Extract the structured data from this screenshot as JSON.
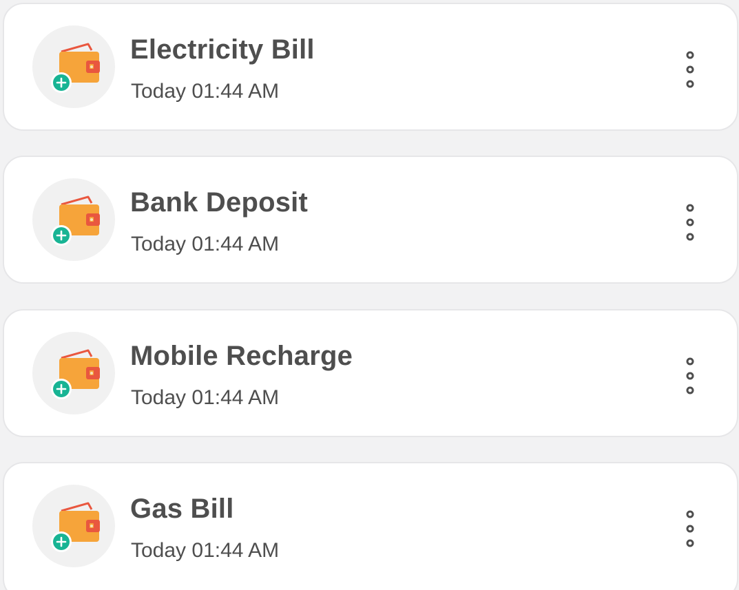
{
  "colors": {
    "card_background": "#ffffff",
    "page_background": "#f2f2f3",
    "icon_circle": "#f1f1f1",
    "wallet_orange": "#f6a43a",
    "wallet_accent": "#e9573f",
    "plus_badge": "#18b494",
    "text": "#4e4e4e"
  },
  "icons": {
    "transaction_icon": "wallet-add-icon",
    "menu_icon": "more-vertical-icon"
  },
  "transactions": [
    {
      "title": "Electricity Bill",
      "time": "Today 01:44 AM"
    },
    {
      "title": "Bank Deposit",
      "time": "Today 01:44 AM"
    },
    {
      "title": "Mobile Recharge",
      "time": "Today 01:44 AM"
    },
    {
      "title": "Gas Bill",
      "time": "Today 01:44 AM"
    }
  ]
}
